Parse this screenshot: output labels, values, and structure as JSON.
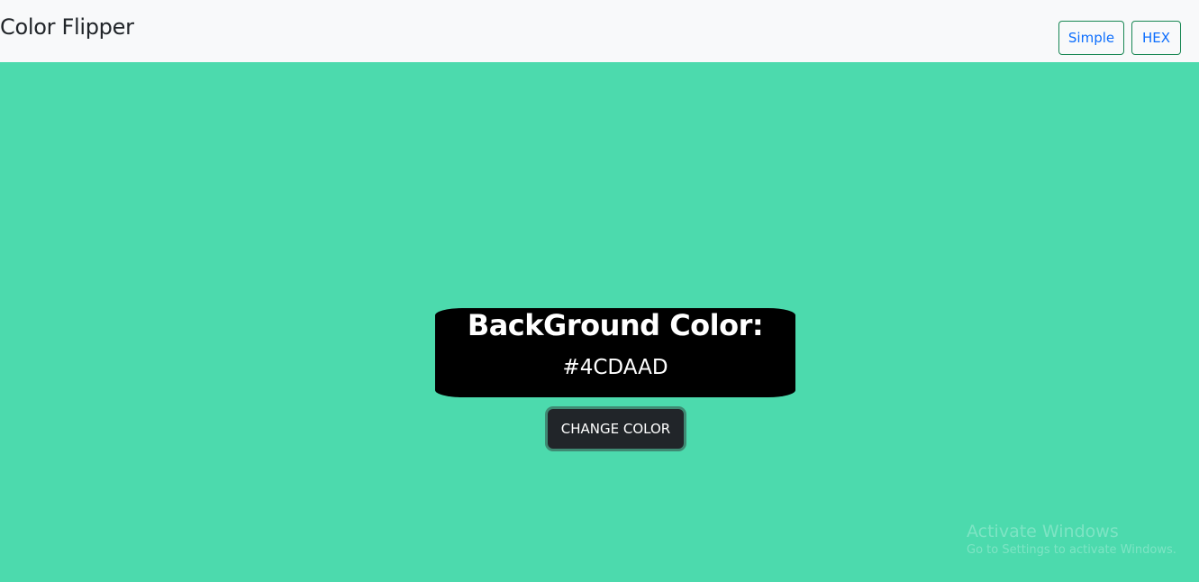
{
  "navbar": {
    "brand": "Color Flipper",
    "links": [
      {
        "label": "Simple"
      },
      {
        "label": "HEX"
      }
    ]
  },
  "main": {
    "background_color": "#4CDAAD",
    "heading": "BackGround Color:",
    "color_value": "#4CDAAD",
    "change_button_label": "CHANGE COLOR"
  },
  "watermark": {
    "title": "Activate Windows",
    "subtitle": "Go to Settings to activate Windows."
  }
}
